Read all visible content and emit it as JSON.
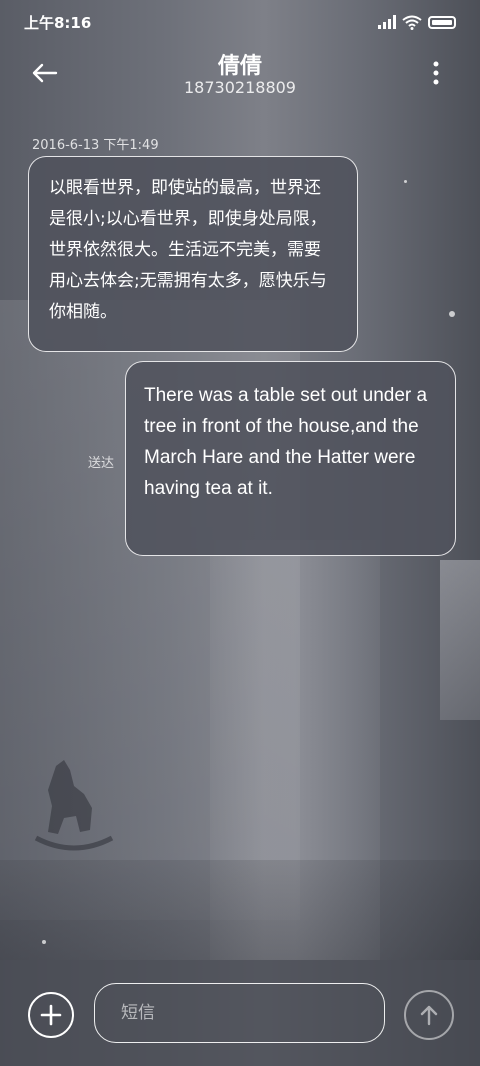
{
  "status_bar": {
    "time": "上午8:16",
    "icons": [
      "signal-icon",
      "wifi-icon",
      "battery-icon"
    ]
  },
  "header": {
    "contact_name": "倩倩",
    "contact_number": "18730218809",
    "back_icon": "arrow-left-icon",
    "more_icon": "more-vertical-icon"
  },
  "conversation": {
    "timestamp": "2016-6-13 下午1:49",
    "messages": [
      {
        "direction": "incoming",
        "text": "以眼看世界，即使站的最高，世界还是很小;以心看世界，即使身处局限，世界依然很大。生活远不完美，需要用心去体会;无需拥有太多，愿快乐与你相随。"
      },
      {
        "direction": "outgoing",
        "text": "There was a table set out under a tree in front of the house,and the March Hare and the Hatter were having tea at it.",
        "status": "送达"
      }
    ]
  },
  "composer": {
    "placeholder": "短信",
    "value": "",
    "add_icon": "plus-icon",
    "send_icon": "arrow-up-icon"
  },
  "colors": {
    "bubble_bg": "#50525c",
    "bubble_border": "#ffffff",
    "text": "#ffffff"
  }
}
